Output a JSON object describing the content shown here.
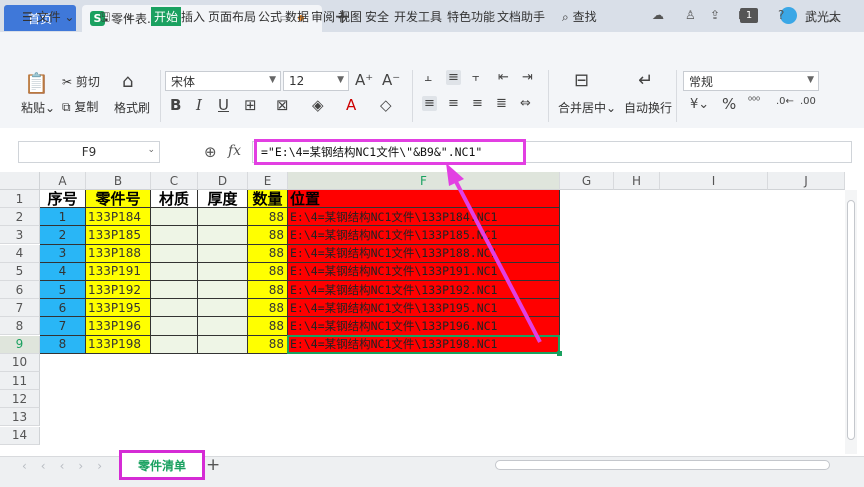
{
  "titlebar": {
    "home_tab": "首页",
    "file_tab": "零件表.xlsx",
    "badge": "1",
    "user": "武光太"
  },
  "menu": {
    "file": "文件",
    "items": [
      "开始",
      "插入",
      "页面布局",
      "公式",
      "数据",
      "审阅",
      "视图",
      "安全",
      "开发工具",
      "特色功能",
      "文档助手"
    ],
    "search": "查找"
  },
  "ribbon": {
    "paste": "粘贴",
    "cut": "剪切",
    "copy": "复制",
    "format_painter": "格式刷",
    "font_name": "宋体",
    "font_size": "12",
    "merge_center": "合并居中",
    "wrap_text": "自动换行",
    "number_format": "常规"
  },
  "formula_bar": {
    "name_box": "F9",
    "fx": "fx",
    "formula": "=\"E:\\4=某钢结构NC1文件\\\"&B9&\".NC1\""
  },
  "grid": {
    "columns": [
      "A",
      "B",
      "C",
      "D",
      "E",
      "F",
      "G",
      "H",
      "I",
      "J"
    ],
    "rows": [
      "1",
      "2",
      "3",
      "4",
      "5",
      "6",
      "7",
      "8",
      "9",
      "10",
      "11",
      "12",
      "13",
      "14"
    ],
    "headers": [
      "序号",
      "零件号",
      "材质",
      "厚度",
      "数量",
      "位置"
    ],
    "data": [
      {
        "no": "1",
        "part": "133P184",
        "qty": "88",
        "loc": "E:\\4=某钢结构NC1文件\\133P184.NC1"
      },
      {
        "no": "2",
        "part": "133P185",
        "qty": "88",
        "loc": "E:\\4=某钢结构NC1文件\\133P185.NC1"
      },
      {
        "no": "3",
        "part": "133P188",
        "qty": "88",
        "loc": "E:\\4=某钢结构NC1文件\\133P188.NC1"
      },
      {
        "no": "4",
        "part": "133P191",
        "qty": "88",
        "loc": "E:\\4=某钢结构NC1文件\\133P191.NC1"
      },
      {
        "no": "5",
        "part": "133P192",
        "qty": "88",
        "loc": "E:\\4=某钢结构NC1文件\\133P192.NC1"
      },
      {
        "no": "6",
        "part": "133P195",
        "qty": "88",
        "loc": "E:\\4=某钢结构NC1文件\\133P195.NC1"
      },
      {
        "no": "7",
        "part": "133P196",
        "qty": "88",
        "loc": "E:\\4=某钢结构NC1文件\\133P196.NC1"
      },
      {
        "no": "8",
        "part": "133P198",
        "qty": "88",
        "loc": "E:\\4=某钢结构NC1文件\\133P198.NC1"
      }
    ]
  },
  "sheets": {
    "active": "零件清单",
    "add": "+"
  },
  "colors": {
    "accent": "#1aa160",
    "highlight": "#e23fe2",
    "col_a": "#29b6f6",
    "col_b": "#ffff00",
    "col_e": "#ffff00",
    "col_f": "#ff0000",
    "empty_cd": "#eef5e6"
  }
}
